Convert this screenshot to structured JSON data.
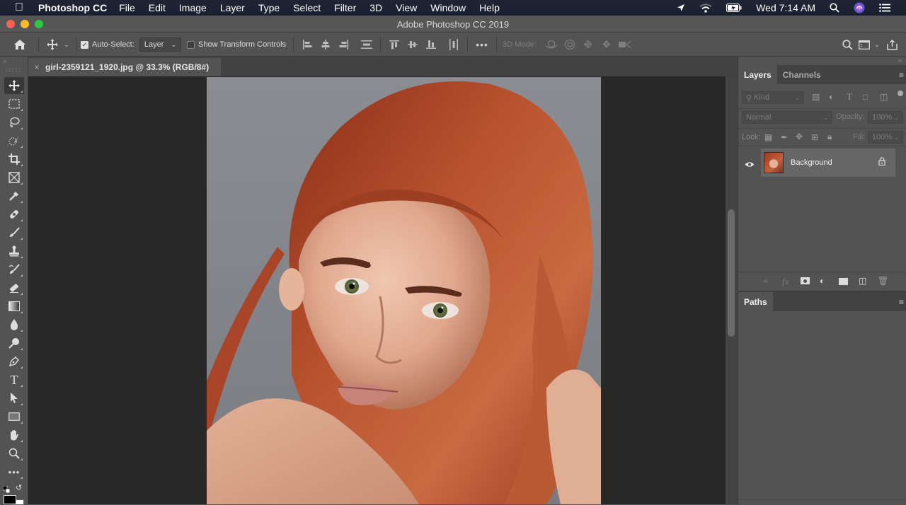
{
  "menubar": {
    "apple_icon": "",
    "app_name": "Photoshop CC",
    "menus": [
      "File",
      "Edit",
      "Image",
      "Layer",
      "Type",
      "Select",
      "Filter",
      "3D",
      "View",
      "Window",
      "Help"
    ],
    "clock": "Wed 7:14 AM",
    "status_icons": [
      "location-icon",
      "wifi-icon",
      "battery-charging-icon",
      "spotlight-search-icon",
      "siri-icon",
      "notification-center-icon"
    ]
  },
  "window": {
    "title": "Adobe Photoshop CC 2019",
    "traffic_colors": {
      "close": "#fe5f57",
      "minimize": "#febb2e",
      "zoom": "#29c840"
    }
  },
  "options": {
    "auto_select_label": "Auto-Select:",
    "auto_select_checked": true,
    "auto_select_target": "Layer",
    "show_transform_label": "Show Transform Controls",
    "show_transform_checked": false,
    "mode_3d_label": "3D Mode:"
  },
  "document": {
    "tab_title": "girl-2359121_1920.jpg @ 33.3% (RGB/8#)",
    "close_glyph": "×",
    "zoom_percent": 33.3
  },
  "tools": [
    "move",
    "rectangular-marquee",
    "lasso",
    "quick-selection",
    "crop",
    "frame",
    "eyedropper",
    "spot-healing-brush",
    "brush",
    "clone-stamp",
    "history-brush",
    "eraser",
    "gradient",
    "blur",
    "dodge",
    "pen",
    "type",
    "path-selection",
    "rectangle",
    "hand",
    "zoom",
    "edit-toolbar"
  ],
  "layers_panel": {
    "tabs": [
      "Layers",
      "Channels"
    ],
    "active_tab": "Layers",
    "filter_placeholder": "Kind",
    "blend_mode": "Normal",
    "opacity_label": "Opacity:",
    "opacity_value": "100%",
    "lock_label": "Lock:",
    "fill_label": "Fill:",
    "fill_value": "100%",
    "layers": [
      {
        "name": "Background",
        "visible": true,
        "locked": true
      }
    ],
    "footer_icons": [
      "link-layers-icon",
      "fx-icon",
      "add-mask-icon",
      "adjustment-layer-icon",
      "new-group-icon",
      "new-layer-icon",
      "delete-layer-icon"
    ]
  },
  "paths_panel": {
    "tabs": [
      "Paths"
    ],
    "active_tab": "Paths"
  },
  "colors": {
    "foreground": "#000000",
    "background": "#ffffff"
  }
}
